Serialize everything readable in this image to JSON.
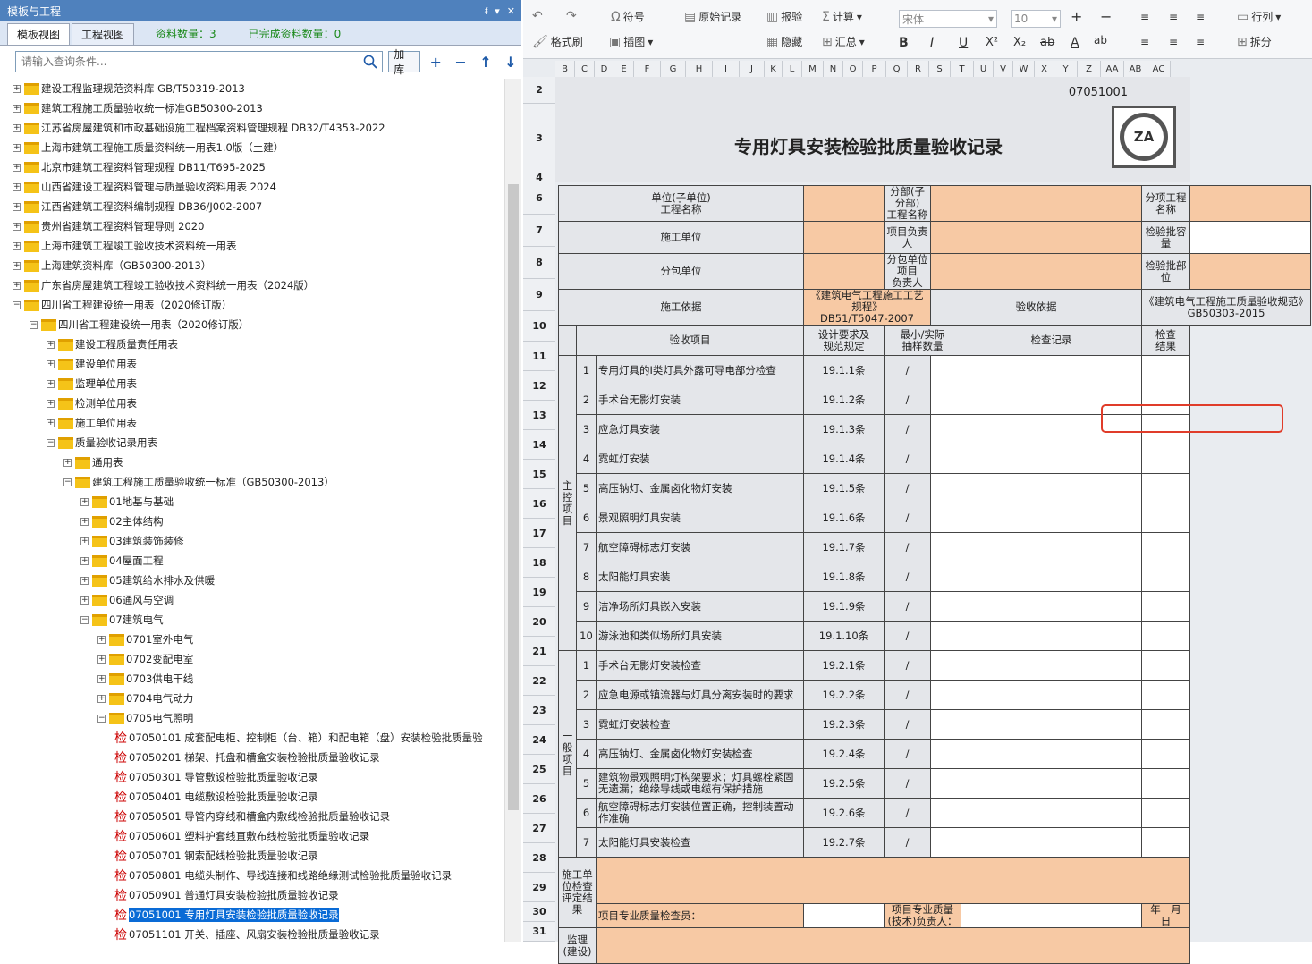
{
  "panel": {
    "title": "模板与工程",
    "pin": "ᵮ",
    "dropdown": "▾",
    "close": "✕"
  },
  "tabs": [
    {
      "label": "模板视图"
    },
    {
      "label": "工程视图"
    }
  ],
  "stats": {
    "count": "资料数量：3",
    "done": "已完成资料数量：0"
  },
  "search": {
    "placeholder": "请输入查询条件...",
    "load": "加库"
  },
  "tree": [
    {
      "lvl": 0,
      "label": "建设工程监理规范资料库 GB/T50319-2013"
    },
    {
      "lvl": 0,
      "label": "建筑工程施工质量验收统一标准GB50300-2013"
    },
    {
      "lvl": 0,
      "label": "江苏省房屋建筑和市政基础设施工程档案资料管理规程 DB32/T4353-2022"
    },
    {
      "lvl": 0,
      "label": "上海市建筑工程施工质量资料统一用表1.0版（土建）"
    },
    {
      "lvl": 0,
      "label": "北京市建筑工程资料管理规程 DB11/T695-2025"
    },
    {
      "lvl": 0,
      "label": "山西省建设工程资料管理与质量验收资料用表 2024"
    },
    {
      "lvl": 0,
      "label": "江西省建筑工程资料编制规程 DB36/J002-2007"
    },
    {
      "lvl": 0,
      "label": "贵州省建筑工程资料管理导则 2020"
    },
    {
      "lvl": 0,
      "label": "上海市建筑工程竣工验收技术资料统一用表"
    },
    {
      "lvl": 0,
      "label": "上海建筑资料库（GB50300-2013）"
    },
    {
      "lvl": 0,
      "label": "广东省房屋建筑工程竣工验收技术资料统一用表（2024版）"
    },
    {
      "lvl": 0,
      "label": "四川省工程建设统一用表（2020修订版）",
      "open": true
    },
    {
      "lvl": 1,
      "label": "四川省工程建设统一用表（2020修订版）",
      "open": true
    },
    {
      "lvl": 2,
      "label": "建设工程质量责任用表"
    },
    {
      "lvl": 2,
      "label": "建设单位用表"
    },
    {
      "lvl": 2,
      "label": "监理单位用表"
    },
    {
      "lvl": 2,
      "label": "检测单位用表"
    },
    {
      "lvl": 2,
      "label": "施工单位用表"
    },
    {
      "lvl": 2,
      "label": "质量验收记录用表",
      "open": true
    },
    {
      "lvl": 3,
      "label": "通用表"
    },
    {
      "lvl": 3,
      "label": "建筑工程施工质量验收统一标准（GB50300-2013）",
      "open": true
    },
    {
      "lvl": 4,
      "label": "01地基与基础"
    },
    {
      "lvl": 4,
      "label": "02主体结构"
    },
    {
      "lvl": 4,
      "label": "03建筑装饰装修"
    },
    {
      "lvl": 4,
      "label": "04屋面工程"
    },
    {
      "lvl": 4,
      "label": "05建筑给水排水及供暖"
    },
    {
      "lvl": 4,
      "label": "06通风与空调"
    },
    {
      "lvl": 4,
      "label": "07建筑电气",
      "open": true
    },
    {
      "lvl": 5,
      "label": "0701室外电气"
    },
    {
      "lvl": 5,
      "label": "0702变配电室"
    },
    {
      "lvl": 5,
      "label": "0703供电干线"
    },
    {
      "lvl": 5,
      "label": "0704电气动力"
    },
    {
      "lvl": 5,
      "label": "0705电气照明",
      "open": true
    },
    {
      "lvl": 6,
      "leaf": true,
      "label": "07050101 成套配电柜、控制柜（台、箱）和配电箱（盘）安装检验批质量验"
    },
    {
      "lvl": 6,
      "leaf": true,
      "label": "07050201 梯架、托盘和槽盒安装检验批质量验收记录"
    },
    {
      "lvl": 6,
      "leaf": true,
      "label": "07050301 导管敷设检验批质量验收记录"
    },
    {
      "lvl": 6,
      "leaf": true,
      "label": "07050401 电缆敷设检验批质量验收记录"
    },
    {
      "lvl": 6,
      "leaf": true,
      "label": "07050501 导管内穿线和槽盒内敷线检验批质量验收记录"
    },
    {
      "lvl": 6,
      "leaf": true,
      "label": "07050601 塑料护套线直敷布线检验批质量验收记录"
    },
    {
      "lvl": 6,
      "leaf": true,
      "label": "07050701 钢索配线检验批质量验收记录"
    },
    {
      "lvl": 6,
      "leaf": true,
      "label": "07050801 电缆头制作、导线连接和线路绝缘测试检验批质量验收记录"
    },
    {
      "lvl": 6,
      "leaf": true,
      "label": "07050901 普通灯具安装检验批质量验收记录"
    },
    {
      "lvl": 6,
      "leaf": true,
      "sel": true,
      "label": "07051001 专用灯具安装检验批质量验收记录"
    },
    {
      "lvl": 6,
      "leaf": true,
      "label": "07051101 开关、插座、风扇安装检验批质量验收记录"
    }
  ],
  "leaf_mark": "检",
  "ribbon": {
    "symbol": "符号",
    "raw": "原始记录",
    "report": "报验",
    "calc": "计算",
    "font": "宋体",
    "size": "10",
    "format_brush": "格式刷",
    "insert_pic": "插图",
    "hide": "隐藏",
    "summary": "汇总",
    "rowcol": "行列",
    "split": "拆分",
    "bold": "B",
    "italic": "I",
    "underline": "U",
    "sup": "X²",
    "sub": "X₂",
    "strike": "ab",
    "color": "A"
  },
  "columns": [
    "B",
    "C",
    "D",
    "E",
    "F",
    "G",
    "H",
    "I",
    "J",
    "K",
    "L",
    "M",
    "N",
    "O",
    "P",
    "Q",
    "R",
    "S",
    "T",
    "U",
    "V",
    "W",
    "X",
    "Y",
    "Z",
    "AA",
    "AB",
    "AC"
  ],
  "doc": {
    "number": "07051001",
    "title": "专用灯具安装检验批质量验收记录",
    "logo_text": "ZA",
    "unit_label": "单位(子单位)\n工程名称",
    "part_label": "分部(子分部)\n工程名称",
    "sub_label": "分项工程名称",
    "constr_unit": "施工单位",
    "pm": "项目负责人",
    "capacity": "检验批容量",
    "subcontract": "分包单位",
    "sub_pm": "分包单位项目\n负责人",
    "location": "检验批部位",
    "basis_label": "施工依据",
    "basis_value": "《建筑电气工程施工工艺规程》\nDB51/T5047-2007",
    "accept_label": "验收依据",
    "accept_value": "《建筑电气工程施工质量验收规范》\nGB50303-2015",
    "h_item": "验收项目",
    "h_design": "设计要求及\n规范规定",
    "h_sample": "最小/实际\n抽样数量",
    "h_record": "检查记录",
    "h_result": "检查\n结果",
    "main_group": "主\n控\n项\n目",
    "general_group": "一\n般\n项\n目",
    "main_items": [
      {
        "n": "1",
        "name": "专用灯具的Ⅰ类灯具外露可导电部分检查",
        "spec": "19.1.1条"
      },
      {
        "n": "2",
        "name": "手术台无影灯安装",
        "spec": "19.1.2条"
      },
      {
        "n": "3",
        "name": "应急灯具安装",
        "spec": "19.1.3条"
      },
      {
        "n": "4",
        "name": "霓虹灯安装",
        "spec": "19.1.4条"
      },
      {
        "n": "5",
        "name": "高压钠灯、金属卤化物灯安装",
        "spec": "19.1.5条"
      },
      {
        "n": "6",
        "name": "景观照明灯具安装",
        "spec": "19.1.6条"
      },
      {
        "n": "7",
        "name": "航空障碍标志灯安装",
        "spec": "19.1.7条"
      },
      {
        "n": "8",
        "name": "太阳能灯具安装",
        "spec": "19.1.8条"
      },
      {
        "n": "9",
        "name": "洁净场所灯具嵌入安装",
        "spec": "19.1.9条"
      },
      {
        "n": "10",
        "name": "游泳池和类似场所灯具安装",
        "spec": "19.1.10条"
      }
    ],
    "general_items": [
      {
        "n": "1",
        "name": "手术台无影灯安装检查",
        "spec": "19.2.1条"
      },
      {
        "n": "2",
        "name": "应急电源或镇流器与灯具分离安装时的要求",
        "spec": "19.2.2条"
      },
      {
        "n": "3",
        "name": "霓虹灯安装检查",
        "spec": "19.2.3条"
      },
      {
        "n": "4",
        "name": "高压钠灯、金属卤化物灯安装检查",
        "spec": "19.2.4条"
      },
      {
        "n": "5",
        "name": "建筑物景观照明灯构架要求；灯具螺栓紧固无遗漏；绝缘导线或电缆有保护措施",
        "spec": "19.2.5条"
      },
      {
        "n": "6",
        "name": "航空障碍标志灯安装位置正确，控制装置动作准确",
        "spec": "19.2.6条"
      },
      {
        "n": "7",
        "name": "太阳能灯具安装检查",
        "spec": "19.2.7条"
      }
    ],
    "slash": "/",
    "conclusion_label": "施工单位检查\n评定结果",
    "inspector": "项目专业质量检查员：",
    "tech_lead": "项目专业质量(技术)负责人：",
    "date": "年　月　日",
    "supervision": "监理(建设)"
  },
  "rows": [
    "2",
    "3",
    "4",
    "6",
    "7",
    "8",
    "9",
    "10",
    "11",
    "12",
    "13",
    "14",
    "15",
    "16",
    "17",
    "18",
    "19",
    "20",
    "21",
    "22",
    "23",
    "24",
    "25",
    "26",
    "27",
    "28",
    "29",
    "30",
    "31"
  ]
}
